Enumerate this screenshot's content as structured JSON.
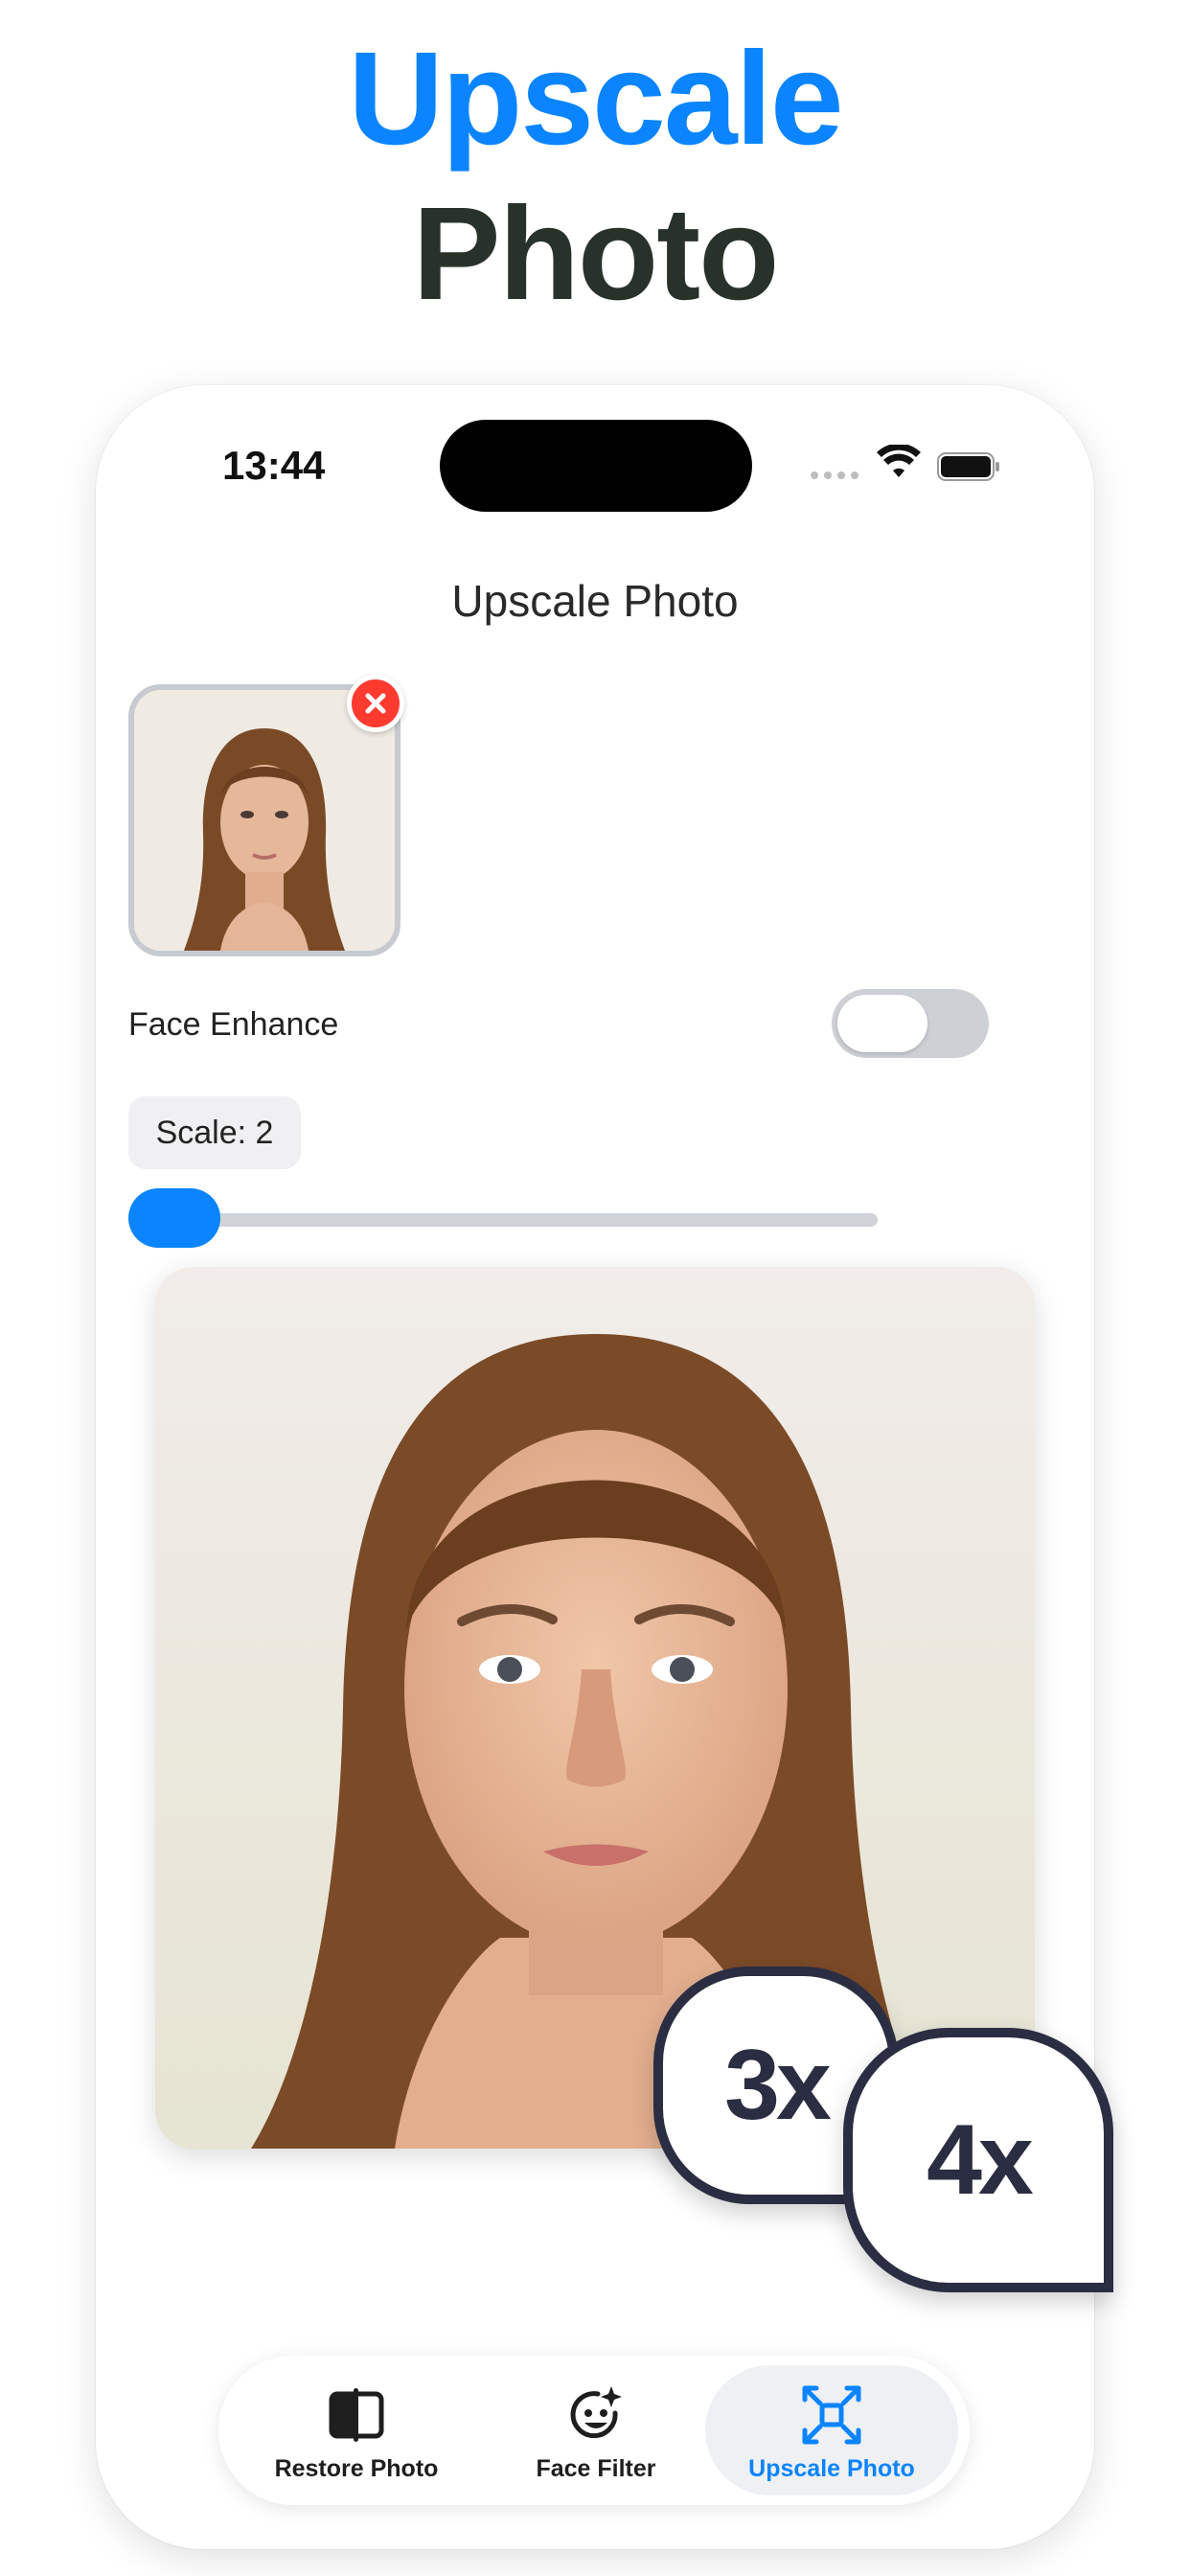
{
  "headline": {
    "line1": "Upscale",
    "line2": "Photo"
  },
  "status_bar": {
    "time": "13:44"
  },
  "nav": {
    "title": "Upscale Photo"
  },
  "controls": {
    "face_enhance_label": "Face Enhance",
    "face_enhance_on": false,
    "scale_label": "Scale: 2",
    "scale_slider_fraction": 0
  },
  "badges": {
    "badge_3x": "3x",
    "badge_4x": "4x"
  },
  "tabbar": {
    "tabs": [
      {
        "label": "Restore Photo",
        "icon": "restore-photo-icon",
        "selected": false
      },
      {
        "label": "Face Filter",
        "icon": "face-filter-icon",
        "selected": false
      },
      {
        "label": "Upscale Photo",
        "icon": "upscale-photo-icon",
        "selected": true
      }
    ]
  },
  "colors": {
    "accent": "#0a84ff",
    "headline_dark": "#27332a",
    "badge_border": "#2b2d42",
    "remove_red": "#ff3b30"
  }
}
